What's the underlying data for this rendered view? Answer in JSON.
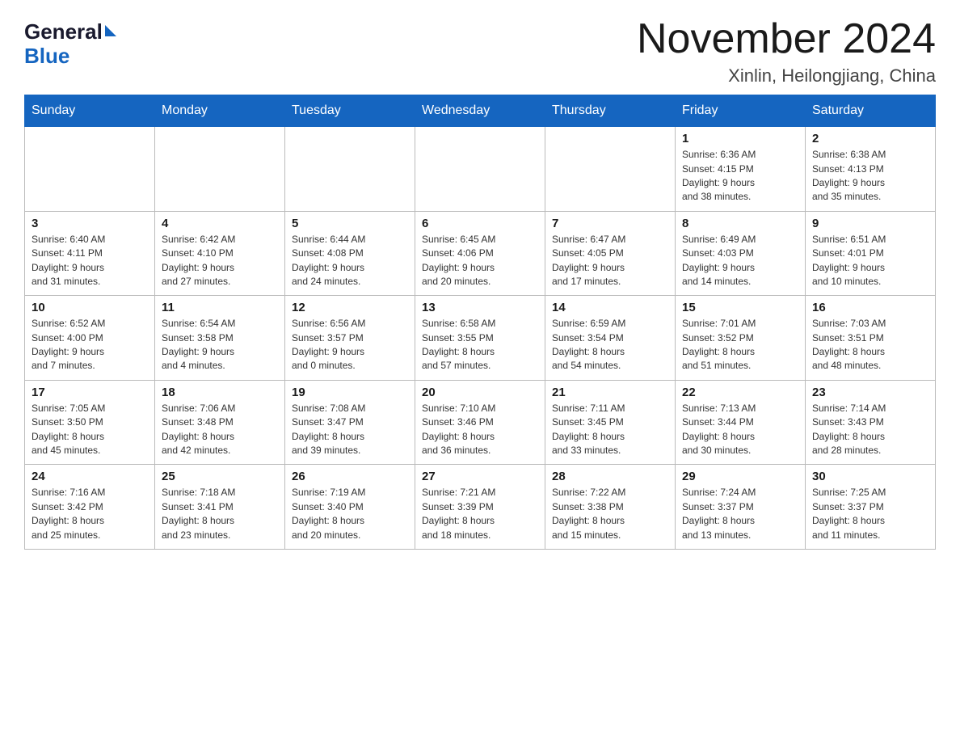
{
  "logo": {
    "general": "General",
    "blue": "Blue"
  },
  "title": "November 2024",
  "location": "Xinlin, Heilongjiang, China",
  "weekdays": [
    "Sunday",
    "Monday",
    "Tuesday",
    "Wednesday",
    "Thursday",
    "Friday",
    "Saturday"
  ],
  "weeks": [
    [
      {
        "day": "",
        "info": ""
      },
      {
        "day": "",
        "info": ""
      },
      {
        "day": "",
        "info": ""
      },
      {
        "day": "",
        "info": ""
      },
      {
        "day": "",
        "info": ""
      },
      {
        "day": "1",
        "info": "Sunrise: 6:36 AM\nSunset: 4:15 PM\nDaylight: 9 hours\nand 38 minutes."
      },
      {
        "day": "2",
        "info": "Sunrise: 6:38 AM\nSunset: 4:13 PM\nDaylight: 9 hours\nand 35 minutes."
      }
    ],
    [
      {
        "day": "3",
        "info": "Sunrise: 6:40 AM\nSunset: 4:11 PM\nDaylight: 9 hours\nand 31 minutes."
      },
      {
        "day": "4",
        "info": "Sunrise: 6:42 AM\nSunset: 4:10 PM\nDaylight: 9 hours\nand 27 minutes."
      },
      {
        "day": "5",
        "info": "Sunrise: 6:44 AM\nSunset: 4:08 PM\nDaylight: 9 hours\nand 24 minutes."
      },
      {
        "day": "6",
        "info": "Sunrise: 6:45 AM\nSunset: 4:06 PM\nDaylight: 9 hours\nand 20 minutes."
      },
      {
        "day": "7",
        "info": "Sunrise: 6:47 AM\nSunset: 4:05 PM\nDaylight: 9 hours\nand 17 minutes."
      },
      {
        "day": "8",
        "info": "Sunrise: 6:49 AM\nSunset: 4:03 PM\nDaylight: 9 hours\nand 14 minutes."
      },
      {
        "day": "9",
        "info": "Sunrise: 6:51 AM\nSunset: 4:01 PM\nDaylight: 9 hours\nand 10 minutes."
      }
    ],
    [
      {
        "day": "10",
        "info": "Sunrise: 6:52 AM\nSunset: 4:00 PM\nDaylight: 9 hours\nand 7 minutes."
      },
      {
        "day": "11",
        "info": "Sunrise: 6:54 AM\nSunset: 3:58 PM\nDaylight: 9 hours\nand 4 minutes."
      },
      {
        "day": "12",
        "info": "Sunrise: 6:56 AM\nSunset: 3:57 PM\nDaylight: 9 hours\nand 0 minutes."
      },
      {
        "day": "13",
        "info": "Sunrise: 6:58 AM\nSunset: 3:55 PM\nDaylight: 8 hours\nand 57 minutes."
      },
      {
        "day": "14",
        "info": "Sunrise: 6:59 AM\nSunset: 3:54 PM\nDaylight: 8 hours\nand 54 minutes."
      },
      {
        "day": "15",
        "info": "Sunrise: 7:01 AM\nSunset: 3:52 PM\nDaylight: 8 hours\nand 51 minutes."
      },
      {
        "day": "16",
        "info": "Sunrise: 7:03 AM\nSunset: 3:51 PM\nDaylight: 8 hours\nand 48 minutes."
      }
    ],
    [
      {
        "day": "17",
        "info": "Sunrise: 7:05 AM\nSunset: 3:50 PM\nDaylight: 8 hours\nand 45 minutes."
      },
      {
        "day": "18",
        "info": "Sunrise: 7:06 AM\nSunset: 3:48 PM\nDaylight: 8 hours\nand 42 minutes."
      },
      {
        "day": "19",
        "info": "Sunrise: 7:08 AM\nSunset: 3:47 PM\nDaylight: 8 hours\nand 39 minutes."
      },
      {
        "day": "20",
        "info": "Sunrise: 7:10 AM\nSunset: 3:46 PM\nDaylight: 8 hours\nand 36 minutes."
      },
      {
        "day": "21",
        "info": "Sunrise: 7:11 AM\nSunset: 3:45 PM\nDaylight: 8 hours\nand 33 minutes."
      },
      {
        "day": "22",
        "info": "Sunrise: 7:13 AM\nSunset: 3:44 PM\nDaylight: 8 hours\nand 30 minutes."
      },
      {
        "day": "23",
        "info": "Sunrise: 7:14 AM\nSunset: 3:43 PM\nDaylight: 8 hours\nand 28 minutes."
      }
    ],
    [
      {
        "day": "24",
        "info": "Sunrise: 7:16 AM\nSunset: 3:42 PM\nDaylight: 8 hours\nand 25 minutes."
      },
      {
        "day": "25",
        "info": "Sunrise: 7:18 AM\nSunset: 3:41 PM\nDaylight: 8 hours\nand 23 minutes."
      },
      {
        "day": "26",
        "info": "Sunrise: 7:19 AM\nSunset: 3:40 PM\nDaylight: 8 hours\nand 20 minutes."
      },
      {
        "day": "27",
        "info": "Sunrise: 7:21 AM\nSunset: 3:39 PM\nDaylight: 8 hours\nand 18 minutes."
      },
      {
        "day": "28",
        "info": "Sunrise: 7:22 AM\nSunset: 3:38 PM\nDaylight: 8 hours\nand 15 minutes."
      },
      {
        "day": "29",
        "info": "Sunrise: 7:24 AM\nSunset: 3:37 PM\nDaylight: 8 hours\nand 13 minutes."
      },
      {
        "day": "30",
        "info": "Sunrise: 7:25 AM\nSunset: 3:37 PM\nDaylight: 8 hours\nand 11 minutes."
      }
    ]
  ]
}
